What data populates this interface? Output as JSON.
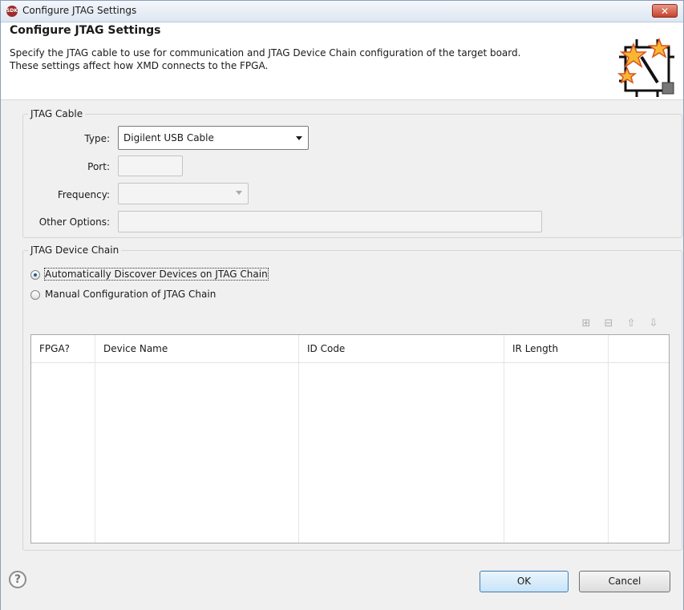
{
  "window": {
    "title": "Configure JTAG Settings",
    "close_label": "✕",
    "app_icon_text": "SDK"
  },
  "header": {
    "title": "Configure JTAG Settings",
    "description_line1": "Specify the JTAG cable to use for communication and JTAG Device Chain configuration of the target board.",
    "description_line2": "These settings affect how XMD connects to the FPGA."
  },
  "jtag_cable": {
    "legend": "JTAG Cable",
    "type_label": "Type:",
    "type_value": "Digilent USB Cable",
    "port_label": "Port:",
    "port_value": "",
    "frequency_label": "Frequency:",
    "frequency_value": "",
    "other_options_label": "Other Options:",
    "other_options_value": ""
  },
  "device_chain": {
    "legend": "JTAG Device Chain",
    "auto_label": "Automatically Discover Devices on JTAG Chain",
    "manual_label": "Manual Configuration of JTAG Chain",
    "selected": "auto",
    "toolbar_icons": [
      "add-device-icon",
      "remove-device-icon",
      "move-up-icon",
      "move-down-icon"
    ],
    "table": {
      "columns": [
        "FPGA?",
        "Device Name",
        "ID Code",
        "IR Length"
      ],
      "rows": []
    }
  },
  "footer": {
    "help_label": "?",
    "ok_label": "OK",
    "cancel_label": "Cancel"
  }
}
